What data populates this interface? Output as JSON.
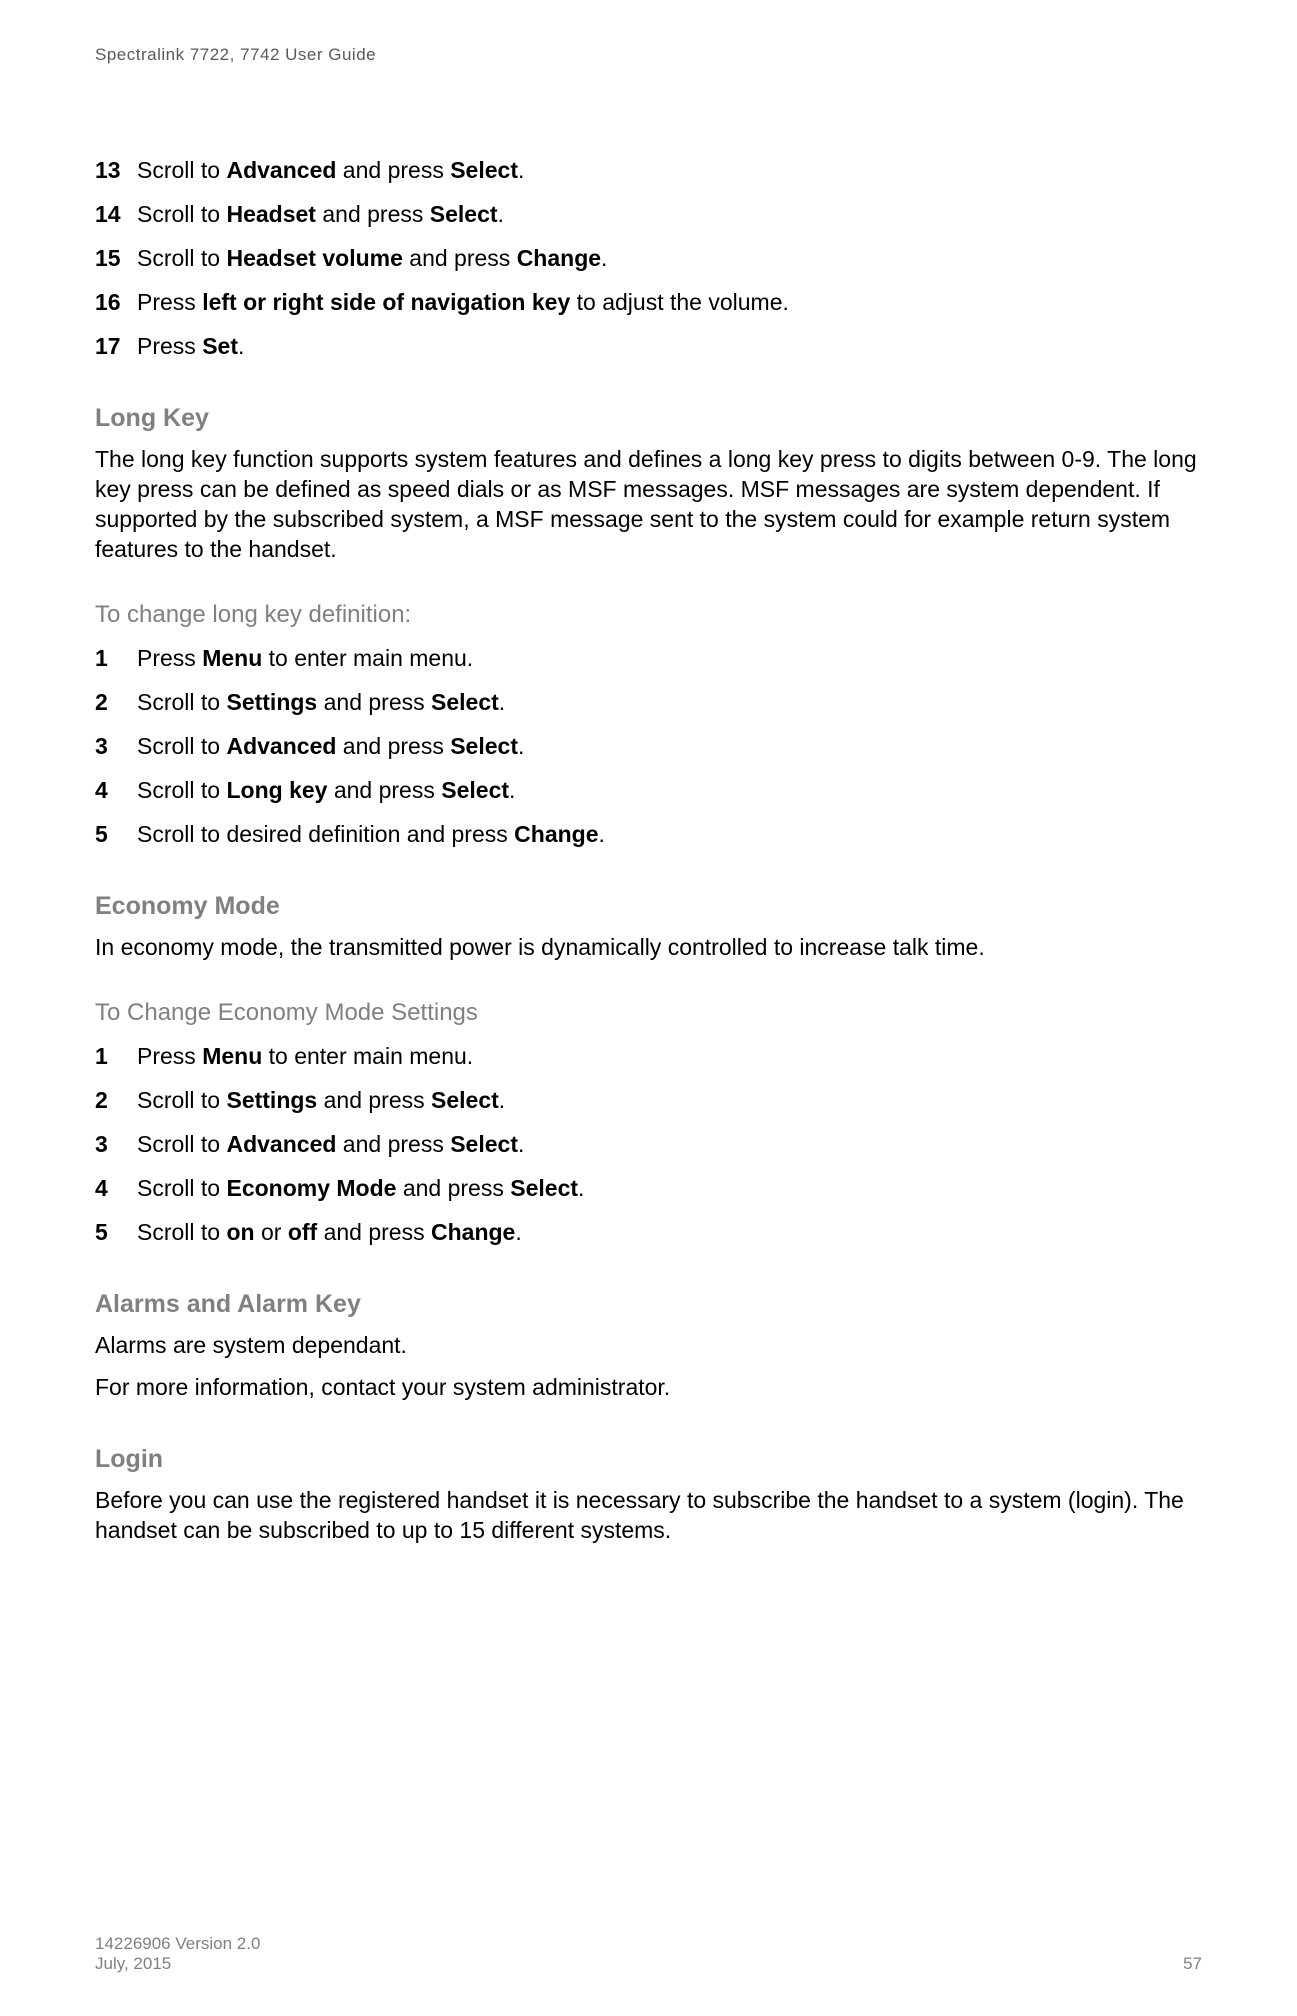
{
  "header": {
    "title": "Spectralink 7722, 7742  User Guide"
  },
  "steps_continued": [
    {
      "num": "13",
      "parts": [
        "Scroll to ",
        "Advanced",
        " and press ",
        "Select",
        "."
      ]
    },
    {
      "num": "14",
      "parts": [
        "Scroll to ",
        "Headset",
        " and press ",
        "Select",
        "."
      ]
    },
    {
      "num": "15",
      "parts": [
        "Scroll to ",
        "Headset volume",
        " and press ",
        "Change",
        "."
      ]
    },
    {
      "num": "16",
      "parts": [
        "Press ",
        "left or right side of navigation key",
        " to adjust the volume."
      ]
    },
    {
      "num": "17",
      "parts": [
        "Press ",
        "Set",
        "."
      ]
    }
  ],
  "longkey": {
    "heading": "Long Key",
    "para": "The long key function supports system features and defines a long key press to digits between 0-9. The long key press can be defined as speed dials or as MSF messages. MSF messages are system dependent. If supported by the subscribed system, a MSF message sent to the system could for example return system features to the handset.",
    "subheading": "To change long key definition:",
    "steps": [
      {
        "num": "1",
        "parts": [
          "Press ",
          "Menu",
          " to enter main menu."
        ]
      },
      {
        "num": "2",
        "parts": [
          "Scroll to ",
          "Settings",
          " and press ",
          "Select",
          "."
        ]
      },
      {
        "num": "3",
        "parts": [
          "Scroll to ",
          "Advanced",
          " and press ",
          "Select",
          "."
        ]
      },
      {
        "num": "4",
        "parts": [
          "Scroll to ",
          "Long key",
          " and press ",
          "Select",
          "."
        ]
      },
      {
        "num": "5",
        "parts": [
          "Scroll to desired definition and press ",
          "Change",
          "."
        ]
      }
    ]
  },
  "economy": {
    "heading": "Economy Mode",
    "para": "In economy mode, the transmitted power is dynamically controlled to increase talk time.",
    "subheading": "To Change Economy Mode Settings",
    "steps": [
      {
        "num": "1",
        "parts": [
          "Press ",
          "Menu",
          " to enter main menu."
        ]
      },
      {
        "num": "2",
        "parts": [
          "Scroll to ",
          "Settings",
          " and press ",
          "Select",
          "."
        ]
      },
      {
        "num": "3",
        "parts": [
          "Scroll to ",
          "Advanced",
          " and press ",
          "Select",
          "."
        ]
      },
      {
        "num": "4",
        "parts": [
          "Scroll to ",
          "Economy Mode",
          " and press ",
          "Select",
          "."
        ]
      },
      {
        "num": "5",
        "parts": [
          "Scroll to ",
          "on",
          " or ",
          "off",
          " and press ",
          "Change",
          "."
        ]
      }
    ]
  },
  "alarms": {
    "heading": "Alarms and Alarm Key",
    "para1": "Alarms are system dependant.",
    "para2": "For more information, contact your system administrator."
  },
  "login": {
    "heading": "Login",
    "para": "Before you can use the registered handset it is necessary to subscribe the handset to a system (login). The handset can be subscribed to up to 15 different systems."
  },
  "footer": {
    "version": "14226906 Version 2.0",
    "date": "July, 2015",
    "page": "57"
  }
}
